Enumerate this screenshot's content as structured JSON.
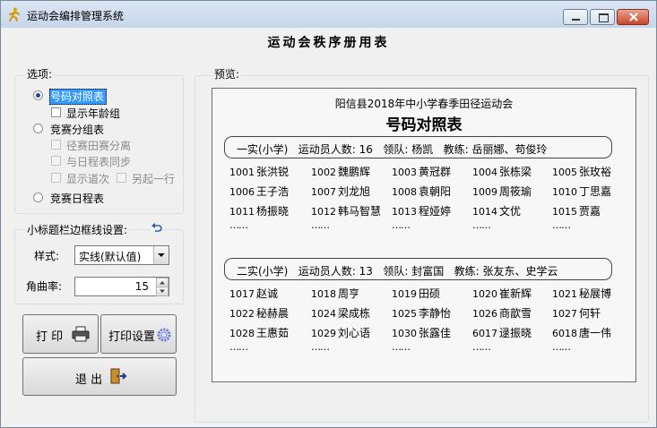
{
  "window": {
    "title": "运动会编排管理系统",
    "subtitle": "运动会秩序册用表"
  },
  "options": {
    "label": "选项:",
    "radios": [
      {
        "label": "号码对照表",
        "checked": true
      },
      {
        "label": "竞赛分组表",
        "checked": false
      },
      {
        "label": "竞赛日程表",
        "checked": false
      }
    ],
    "show_age_group": "显示年龄组",
    "track_field_split": "径赛田赛分离",
    "sync_schedule": "与日程表同步",
    "show_lane": "显示道次",
    "new_line": "另起一行"
  },
  "border_settings": {
    "label": "小标题栏边框线设置:",
    "style_label": "样式:",
    "style_value": "实线(默认值)",
    "corner_label": "角曲率:",
    "corner_value": "15"
  },
  "buttons": {
    "print": "打 印",
    "print_settings": "打印设置",
    "exit": "退 出"
  },
  "preview": {
    "label": "预览:",
    "meet_title": "阳信县2018年中小学春季田径运动会",
    "table_title": "号码对照表",
    "teams": [
      {
        "header": "一实(小学)   运动员人数: 16   领队: 杨凯   教练: 岳丽娜、苟俊玲",
        "athletes": [
          {
            "num": "1001",
            "name": "张洪锐"
          },
          {
            "num": "1002",
            "name": "魏鹏辉"
          },
          {
            "num": "1003",
            "name": "黄冠群"
          },
          {
            "num": "1004",
            "name": "张栋梁"
          },
          {
            "num": "1005",
            "name": "张玫裕"
          },
          {
            "num": "1006",
            "name": "王子浩"
          },
          {
            "num": "1007",
            "name": "刘龙旭"
          },
          {
            "num": "1008",
            "name": "袁朝阳"
          },
          {
            "num": "1009",
            "name": "周筱瑜"
          },
          {
            "num": "1010",
            "name": "丁思嘉"
          },
          {
            "num": "1011",
            "name": "杨振晓"
          },
          {
            "num": "1012",
            "name": "韩马智慧"
          },
          {
            "num": "1013",
            "name": "程娅婷"
          },
          {
            "num": "1014",
            "name": "文优"
          },
          {
            "num": "1015",
            "name": "贾嘉"
          }
        ]
      },
      {
        "header": "二实(小学)   运动员人数: 13   领队: 封富国   教练: 张友东、史学云",
        "athletes": [
          {
            "num": "1017",
            "name": "赵诚"
          },
          {
            "num": "1018",
            "name": "周亨"
          },
          {
            "num": "1019",
            "name": "田硕"
          },
          {
            "num": "1020",
            "name": "崔新辉"
          },
          {
            "num": "1021",
            "name": "秘展博"
          },
          {
            "num": "1022",
            "name": "秘赫晨"
          },
          {
            "num": "1024",
            "name": "梁成栋"
          },
          {
            "num": "1025",
            "name": "李静怡"
          },
          {
            "num": "1026",
            "name": "商歆雪"
          },
          {
            "num": "1027",
            "name": "何轩"
          },
          {
            "num": "1028",
            "name": "王惠茹"
          },
          {
            "num": "1029",
            "name": "刘心语"
          },
          {
            "num": "1030",
            "name": "张露佳"
          },
          {
            "num": "6017",
            "name": "逯振晓"
          },
          {
            "num": "6018",
            "name": "唐一伟"
          }
        ]
      }
    ],
    "ellipsis": "……"
  }
}
